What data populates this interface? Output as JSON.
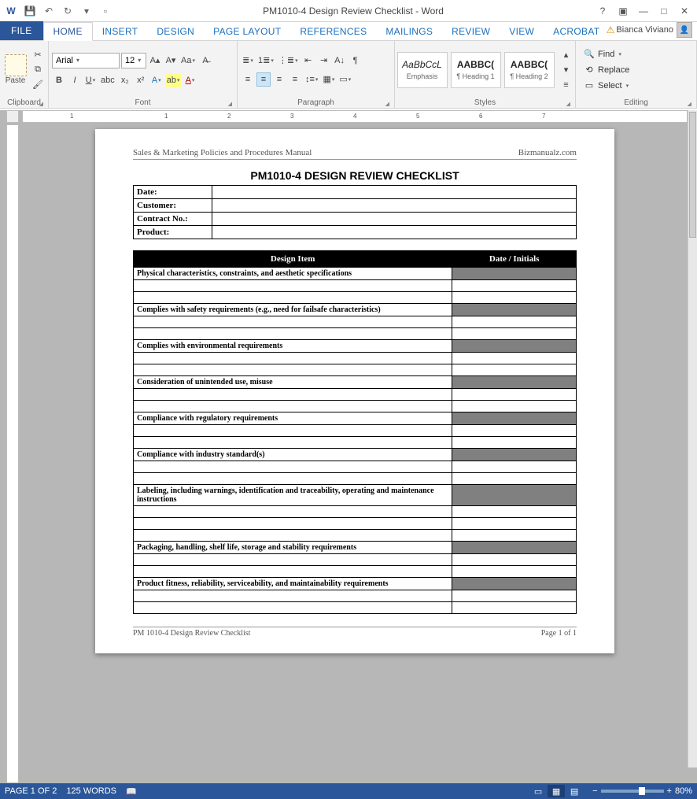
{
  "titlebar": {
    "title": "PM1010-4 Design Review Checklist - Word",
    "user": "Bianca Viviano"
  },
  "tabs": {
    "file": "FILE",
    "items": [
      "HOME",
      "INSERT",
      "DESIGN",
      "PAGE LAYOUT",
      "REFERENCES",
      "MAILINGS",
      "REVIEW",
      "VIEW",
      "ACROBAT"
    ],
    "active": "HOME"
  },
  "ribbon": {
    "clipboard": {
      "paste": "Paste",
      "label": "Clipboard"
    },
    "font": {
      "name": "Arial",
      "size": "12",
      "label": "Font"
    },
    "paragraph": {
      "label": "Paragraph"
    },
    "styles": {
      "items": [
        {
          "preview": "AaBbCcL",
          "name": "Emphasis"
        },
        {
          "preview": "AABBC(",
          "name": "¶ Heading 1"
        },
        {
          "preview": "AABBC(",
          "name": "¶ Heading 2"
        }
      ],
      "label": "Styles"
    },
    "editing": {
      "find": "Find",
      "replace": "Replace",
      "select": "Select",
      "label": "Editing"
    }
  },
  "ruler": {
    "marks": [
      "1",
      "1",
      "2",
      "3",
      "4",
      "5",
      "6",
      "7"
    ]
  },
  "document": {
    "header_left": "Sales & Marketing Policies and Procedures Manual",
    "header_right": "Bizmanualz.com",
    "title": "PM1010-4 DESIGN REVIEW CHECKLIST",
    "info": [
      {
        "label": "Date:",
        "value": ""
      },
      {
        "label": "Customer:",
        "value": ""
      },
      {
        "label": "Contract No.:",
        "value": ""
      },
      {
        "label": "Product:",
        "value": ""
      }
    ],
    "columns": {
      "c1": "Design Item",
      "c2": "Date / Initials"
    },
    "items": [
      "Physical characteristics, constraints, and aesthetic specifications",
      "Complies with safety requirements (e.g., need for failsafe characteristics)",
      "Complies with environmental requirements",
      "Consideration of unintended use, misuse",
      "Compliance with regulatory requirements",
      "Compliance with industry standard(s)",
      "Labeling, including warnings, identification and traceability, operating and maintenance instructions",
      "Packaging, handling, shelf life, storage and stability requirements",
      "Product fitness, reliability, serviceability, and maintainability requirements"
    ],
    "footer_left": "PM 1010-4 Design Review Checklist",
    "footer_right": "Page 1 of 1"
  },
  "statusbar": {
    "page": "PAGE 1 OF 2",
    "words": "125 WORDS",
    "zoom": "80%"
  }
}
